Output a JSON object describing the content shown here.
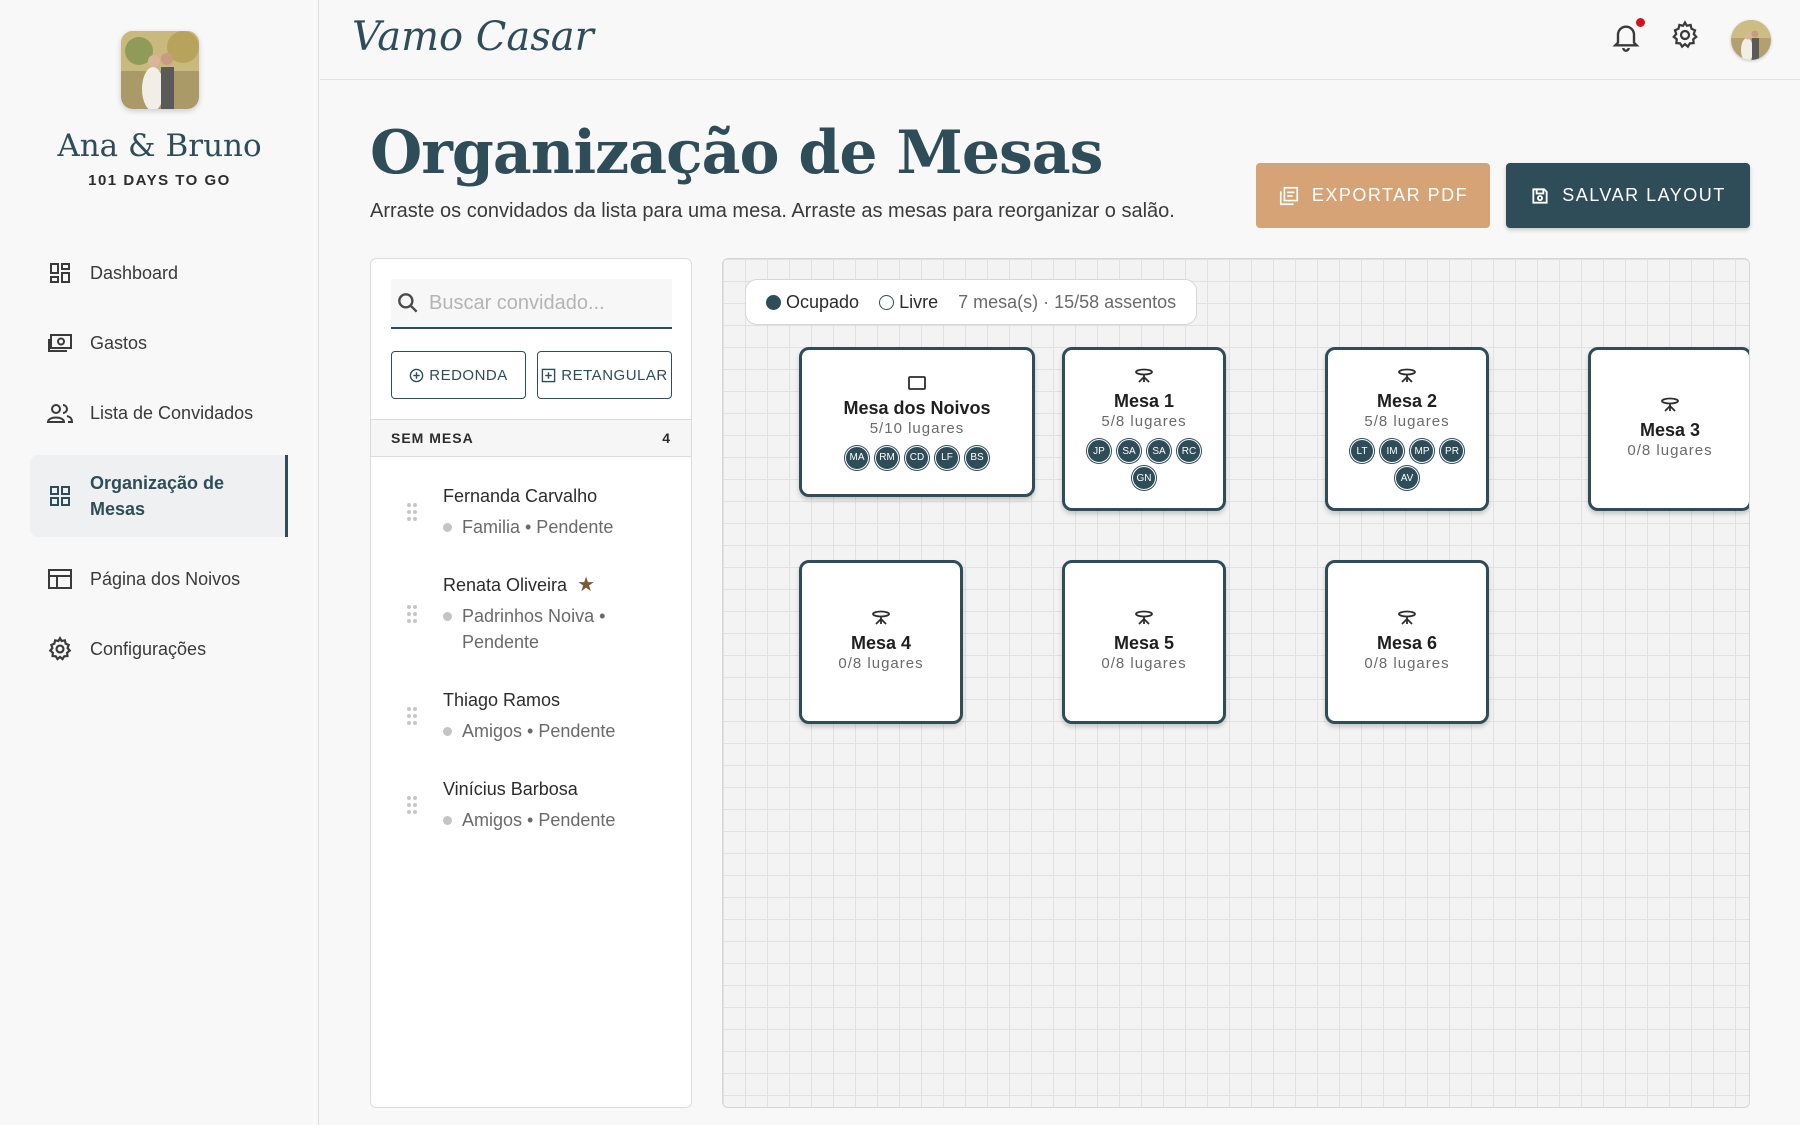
{
  "sidebar": {
    "couple_name": "Ana & Bruno",
    "countdown": "101 DAYS TO GO",
    "items": [
      {
        "label": "Dashboard",
        "icon": "dashboard-icon"
      },
      {
        "label": "Gastos",
        "icon": "money-icon"
      },
      {
        "label": "Lista de Convidados",
        "icon": "people-icon"
      },
      {
        "label": "Organização de Mesas",
        "icon": "grid-icon",
        "active": true
      },
      {
        "label": "Página dos Noivos",
        "icon": "web-page-icon"
      },
      {
        "label": "Configurações",
        "icon": "gear-icon"
      }
    ]
  },
  "header": {
    "brand": "Vamo Casar",
    "notification_dot_color": "#d0141c"
  },
  "main": {
    "title": "Organização de Mesas",
    "subtitle": "Arraste os convidados da lista para uma mesa. Arraste as mesas para reorganizar o salão.",
    "export_label": "EXPORTAR PDF",
    "save_label": "SALVAR LAYOUT"
  },
  "guest_panel": {
    "search_placeholder": "Buscar convidado...",
    "add_round_label": "REDONDA",
    "add_rect_label": "RETANGULAR",
    "unassigned_label": "SEM MESA",
    "unassigned_count": "4",
    "guests": [
      {
        "name": "Fernanda Carvalho",
        "meta": "Familia • Pendente",
        "starred": false
      },
      {
        "name": "Renata Oliveira",
        "meta": "Padrinhos Noiva • Pendente",
        "starred": true
      },
      {
        "name": "Thiago Ramos",
        "meta": "Amigos • Pendente",
        "starred": false
      },
      {
        "name": "Vinícius Barbosa",
        "meta": "Amigos • Pendente",
        "starred": false
      }
    ]
  },
  "canvas": {
    "legend": {
      "occupied": "Ocupado",
      "free": "Livre",
      "summary": "7 mesa(s) · 15/58 assentos"
    },
    "tables": [
      {
        "name": "Mesa dos Noivos",
        "capacity": "5/10 lugares",
        "shape": "rectangular",
        "seats": [
          "MA",
          "RM",
          "CD",
          "LF",
          "BS"
        ]
      },
      {
        "name": "Mesa 1",
        "capacity": "5/8 lugares",
        "shape": "round",
        "seats": [
          "JP",
          "SA",
          "SA",
          "RC",
          "GN"
        ]
      },
      {
        "name": "Mesa 2",
        "capacity": "5/8 lugares",
        "shape": "round",
        "seats": [
          "LT",
          "IM",
          "MP",
          "PR",
          "AV"
        ]
      },
      {
        "name": "Mesa 3",
        "capacity": "0/8 lugares",
        "shape": "round",
        "seats": []
      },
      {
        "name": "Mesa 4",
        "capacity": "0/8 lugares",
        "shape": "round",
        "seats": []
      },
      {
        "name": "Mesa 5",
        "capacity": "0/8 lugares",
        "shape": "round",
        "seats": []
      },
      {
        "name": "Mesa 6",
        "capacity": "0/8 lugares",
        "shape": "round",
        "seats": []
      }
    ]
  },
  "colors": {
    "primary": "#2f4d59",
    "accent": "#d6a376",
    "star": "#7a5a35"
  }
}
